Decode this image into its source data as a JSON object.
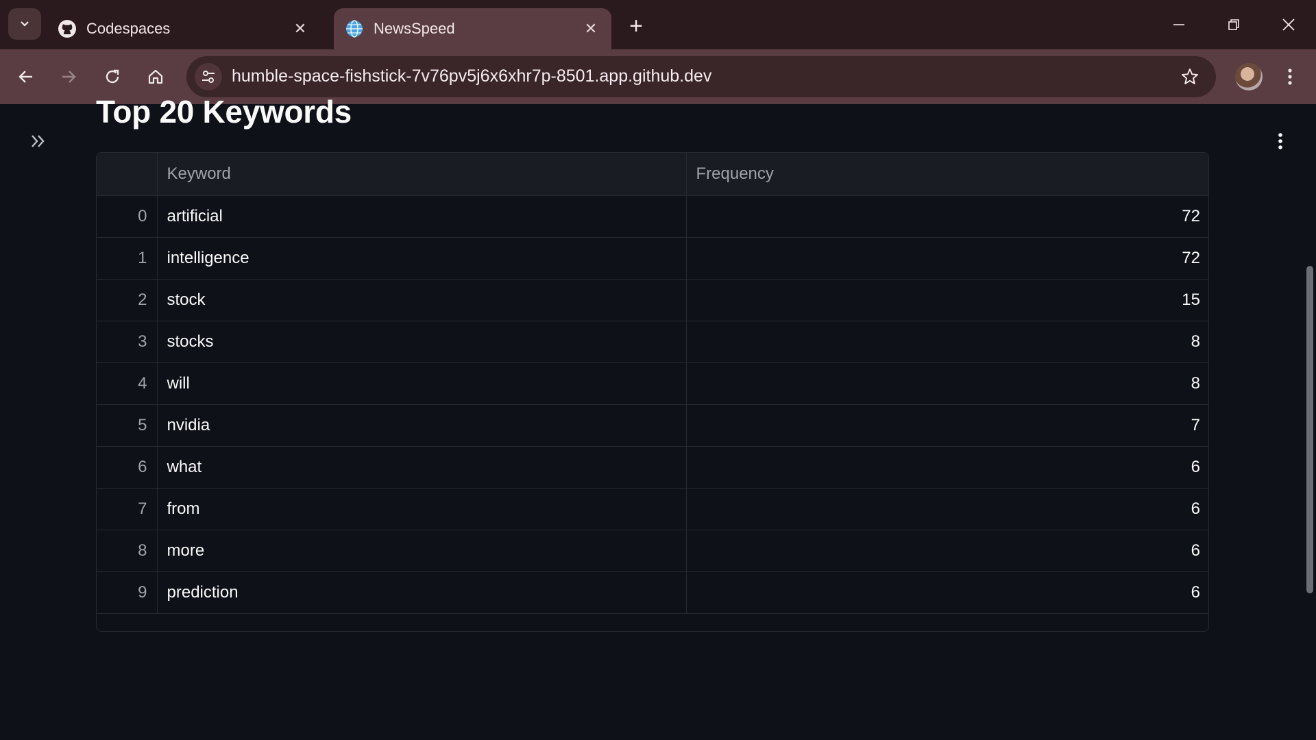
{
  "browser": {
    "tabs": [
      {
        "title": "Codespaces",
        "icon": "github-icon",
        "active": false
      },
      {
        "title": "NewsSpeed",
        "icon": "globe-icon",
        "active": true
      }
    ],
    "url": "humble-space-fishstick-7v76pv5j6x6xhr7p-8501.app.github.dev"
  },
  "page": {
    "heading": "Top 20 Keywords",
    "table": {
      "columns": [
        "Keyword",
        "Frequency"
      ],
      "rows": [
        {
          "index": "0",
          "keyword": "artificial",
          "frequency": "72"
        },
        {
          "index": "1",
          "keyword": "intelligence",
          "frequency": "72"
        },
        {
          "index": "2",
          "keyword": "stock",
          "frequency": "15"
        },
        {
          "index": "3",
          "keyword": "stocks",
          "frequency": "8"
        },
        {
          "index": "4",
          "keyword": "will",
          "frequency": "8"
        },
        {
          "index": "5",
          "keyword": "nvidia",
          "frequency": "7"
        },
        {
          "index": "6",
          "keyword": "what",
          "frequency": "6"
        },
        {
          "index": "7",
          "keyword": "from",
          "frequency": "6"
        },
        {
          "index": "8",
          "keyword": "more",
          "frequency": "6"
        },
        {
          "index": "9",
          "keyword": "prediction",
          "frequency": "6"
        }
      ]
    }
  },
  "colors": {
    "background": "#0e1117",
    "chrome_active": "#5a3d42",
    "chrome_frame": "#2a1a1e"
  }
}
